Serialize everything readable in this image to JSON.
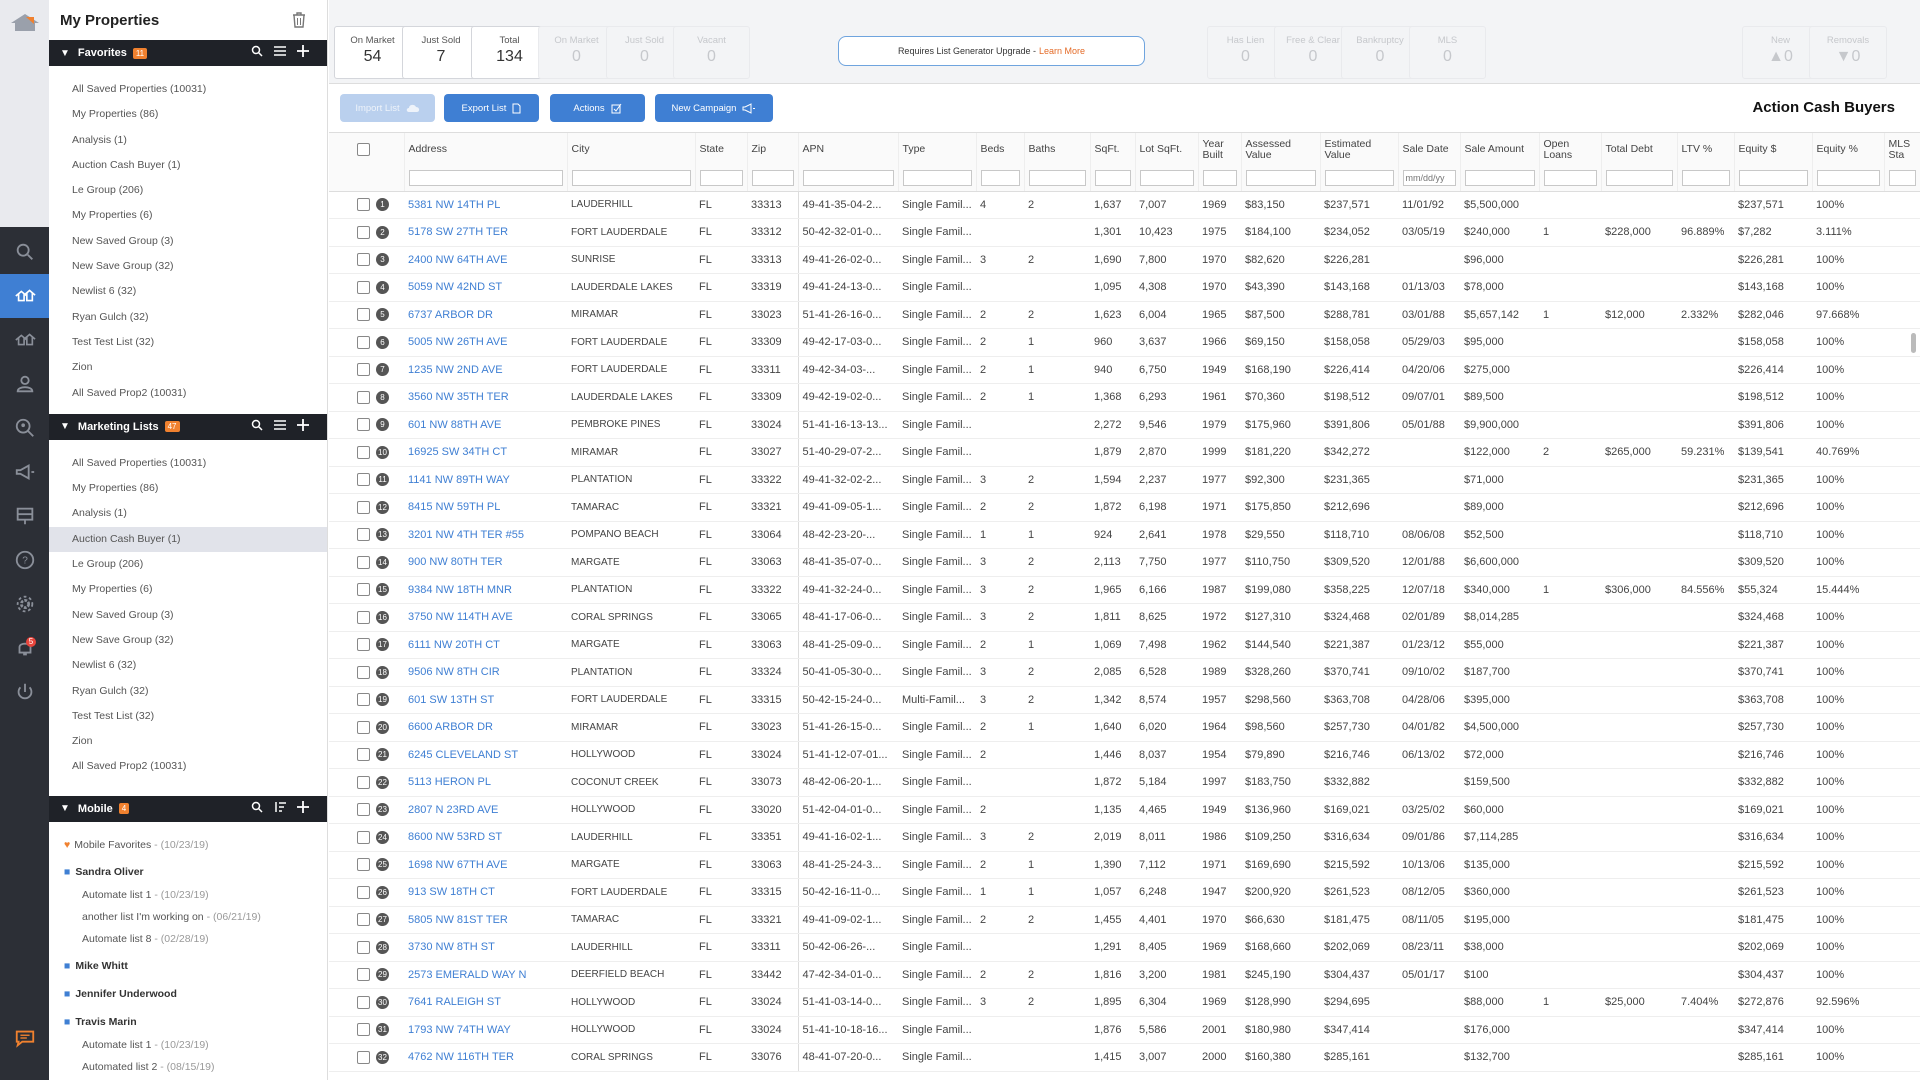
{
  "sidebar": {
    "title": "My Properties",
    "favorites": {
      "label": "Favorites",
      "count": "11"
    },
    "favorite_items": [
      "All Saved Properties (10031)",
      "My Properties (86)",
      "Analysis (1)",
      "Auction Cash Buyer (1)",
      "Le Group (206)",
      "My Properties (6)",
      "New Saved Group (3)",
      "New Save Group (32)",
      "Newlist 6 (32)",
      "Ryan Gulch (32)",
      "Test Test List (32)",
      "Zion",
      "All Saved Prop2 (10031)"
    ],
    "marketing": {
      "label": "Marketing Lists",
      "count": "47"
    },
    "marketing_items": [
      "All Saved Properties (10031)",
      "My Properties (86)",
      "Analysis (1)",
      "Auction Cash Buyer (1)",
      "Le Group (206)",
      "My Properties (6)",
      "New Saved Group (3)",
      "New Save Group (32)",
      "Newlist 6 (32)",
      "Ryan Gulch (32)",
      "Test Test List (32)",
      "Zion",
      "All Saved Prop2 (10031)"
    ],
    "mobile": {
      "label": "Mobile",
      "count": "4"
    },
    "mobile_items": [
      {
        "kind": "fav",
        "label": "Mobile Favorites",
        "date": " - (10/23/19)"
      },
      {
        "kind": "folder",
        "label": "Sandra Oliver"
      },
      {
        "kind": "sub",
        "label": "Automate list 1",
        "date": " - (10/23/19)"
      },
      {
        "kind": "sub",
        "label": "another list I'm working on",
        "date": " - (06/21/19)"
      },
      {
        "kind": "sub",
        "label": "Automate list 8",
        "date": " - (02/28/19)"
      },
      {
        "kind": "folder",
        "label": "Mike Whitt"
      },
      {
        "kind": "folder",
        "label": "Jennifer Underwood"
      },
      {
        "kind": "folder",
        "label": "Travis Marin"
      },
      {
        "kind": "sub",
        "label": "Automate list 1",
        "date": " - (10/23/19)"
      },
      {
        "kind": "sub",
        "label": "Automated list 2",
        "date": " - (08/15/19)"
      }
    ]
  },
  "icon_bar": {
    "notification_count": "5"
  },
  "stats": [
    {
      "label": "On Market",
      "value": "54",
      "dim": false
    },
    {
      "label": "Just Sold",
      "value": "7",
      "dim": false
    },
    {
      "label": "Total",
      "value": "134",
      "dim": false
    },
    {
      "label": "On Market",
      "value": "0",
      "dim": true
    },
    {
      "label": "Just Sold",
      "value": "0",
      "dim": true
    },
    {
      "label": "Vacant",
      "value": "0",
      "dim": true
    },
    {
      "label": "Has Lien",
      "value": "0",
      "dim": true
    },
    {
      "label": "Free & Clear",
      "value": "0",
      "dim": true
    },
    {
      "label": "Bankruptcy",
      "value": "0",
      "dim": true
    },
    {
      "label": "MLS",
      "value": "0",
      "dim": true
    },
    {
      "label": "New",
      "value": "▲0",
      "dim": true
    },
    {
      "label": "Removals",
      "value": "▼0",
      "dim": true
    }
  ],
  "upgrade": {
    "text": "Requires List Generator Upgrade - ",
    "link": "Learn More"
  },
  "toolbar": {
    "import": "Import List",
    "export": "Export List",
    "actions": "Actions",
    "campaign": "New Campaign",
    "list_title": "Action Cash Buyers"
  },
  "table": {
    "columns": [
      "",
      "Address",
      "City",
      "State",
      "Zip",
      "APN",
      "Type",
      "Beds",
      "Baths",
      "SqFt.",
      "Lot SqFt.",
      "Year Built",
      "Assessed Value",
      "Estimated Value",
      "Sale Date",
      "Sale Amount",
      "Open Loans",
      "Total Debt",
      "LTV %",
      "Equity $",
      "Equity %",
      "MLS Sta"
    ],
    "date_placeholder": "mm/dd/yy",
    "rows": [
      [
        "5381 NW 14TH PL",
        "LAUDERHILL",
        "FL",
        "33313",
        "49-41-35-04-2...",
        "Single Famil...",
        "4",
        "2",
        "1,637",
        "7,007",
        "1969",
        "$83,150",
        "$237,571",
        "11/01/92",
        "$5,500,000",
        "",
        "",
        "",
        "$237,571",
        "100%"
      ],
      [
        "5178 SW 27TH TER",
        "FORT LAUDERDALE",
        "FL",
        "33312",
        "50-42-32-01-0...",
        "Single Famil...",
        "",
        "",
        "1,301",
        "10,423",
        "1975",
        "$184,100",
        "$234,052",
        "03/05/19",
        "$240,000",
        "1",
        "$228,000",
        "96.889%",
        "$7,282",
        "3.111%"
      ],
      [
        "2400 NW 64TH AVE",
        "SUNRISE",
        "FL",
        "33313",
        "49-41-26-02-0...",
        "Single Famil...",
        "3",
        "2",
        "1,690",
        "7,800",
        "1970",
        "$82,620",
        "$226,281",
        "",
        "$96,000",
        "",
        "",
        "",
        "$226,281",
        "100%"
      ],
      [
        "5059 NW 42ND ST",
        "LAUDERDALE LAKES",
        "FL",
        "33319",
        "49-41-24-13-0...",
        "Single Famil...",
        "",
        "",
        "1,095",
        "4,308",
        "1970",
        "$43,390",
        "$143,168",
        "01/13/03",
        "$78,000",
        "",
        "",
        "",
        "$143,168",
        "100%"
      ],
      [
        "6737 ARBOR DR",
        "MIRAMAR",
        "FL",
        "33023",
        "51-41-26-16-0...",
        "Single Famil...",
        "2",
        "2",
        "1,623",
        "6,004",
        "1965",
        "$87,500",
        "$288,781",
        "03/01/88",
        "$5,657,142",
        "1",
        "$12,000",
        "2.332%",
        "$282,046",
        "97.668%"
      ],
      [
        "5005 NW 26TH AVE",
        "FORT LAUDERDALE",
        "FL",
        "33309",
        "49-42-17-03-0...",
        "Single Famil...",
        "2",
        "1",
        "960",
        "3,637",
        "1966",
        "$69,150",
        "$158,058",
        "05/29/03",
        "$95,000",
        "",
        "",
        "",
        "$158,058",
        "100%"
      ],
      [
        "1235 NW 2ND AVE",
        "FORT LAUDERDALE",
        "FL",
        "33311",
        "49-42-34-03-...",
        "Single Famil...",
        "2",
        "1",
        "940",
        "6,750",
        "1949",
        "$168,190",
        "$226,414",
        "04/20/06",
        "$275,000",
        "",
        "",
        "",
        "$226,414",
        "100%"
      ],
      [
        "3560 NW 35TH TER",
        "LAUDERDALE LAKES",
        "FL",
        "33309",
        "49-42-19-02-0...",
        "Single Famil...",
        "2",
        "1",
        "1,368",
        "6,293",
        "1961",
        "$70,360",
        "$198,512",
        "09/07/01",
        "$89,500",
        "",
        "",
        "",
        "$198,512",
        "100%"
      ],
      [
        "601 NW 88TH AVE",
        "PEMBROKE PINES",
        "FL",
        "33024",
        "51-41-16-13-13...",
        "Single Famil...",
        "",
        "",
        "2,272",
        "9,546",
        "1979",
        "$175,960",
        "$391,806",
        "05/01/88",
        "$9,900,000",
        "",
        "",
        "",
        "$391,806",
        "100%"
      ],
      [
        "16925 SW 34TH CT",
        "MIRAMAR",
        "FL",
        "33027",
        "51-40-29-07-2...",
        "Single Famil...",
        "",
        "",
        "1,879",
        "2,870",
        "1999",
        "$181,220",
        "$342,272",
        "",
        "$122,000",
        "2",
        "$265,000",
        "59.231%",
        "$139,541",
        "40.769%"
      ],
      [
        "1141 NW 89TH WAY",
        "PLANTATION",
        "FL",
        "33322",
        "49-41-32-02-2...",
        "Single Famil...",
        "3",
        "2",
        "1,594",
        "2,237",
        "1977",
        "$92,300",
        "$231,365",
        "",
        "$71,000",
        "",
        "",
        "",
        "$231,365",
        "100%"
      ],
      [
        "8415 NW 59TH PL",
        "TAMARAC",
        "FL",
        "33321",
        "49-41-09-05-1...",
        "Single Famil...",
        "2",
        "2",
        "1,872",
        "6,198",
        "1971",
        "$175,850",
        "$212,696",
        "",
        "$89,000",
        "",
        "",
        "",
        "$212,696",
        "100%"
      ],
      [
        "3201 NW 4TH TER #55",
        "POMPANO BEACH",
        "FL",
        "33064",
        "48-42-23-20-...",
        "Single Famil...",
        "1",
        "1",
        "924",
        "2,641",
        "1978",
        "$29,550",
        "$118,710",
        "08/06/08",
        "$52,500",
        "",
        "",
        "",
        "$118,710",
        "100%"
      ],
      [
        "900 NW 80TH TER",
        "MARGATE",
        "FL",
        "33063",
        "48-41-35-07-0...",
        "Single Famil...",
        "3",
        "2",
        "2,113",
        "7,750",
        "1977",
        "$110,750",
        "$309,520",
        "12/01/88",
        "$6,600,000",
        "",
        "",
        "",
        "$309,520",
        "100%"
      ],
      [
        "9384 NW 18TH MNR",
        "PLANTATION",
        "FL",
        "33322",
        "49-41-32-24-0...",
        "Single Famil...",
        "3",
        "2",
        "1,965",
        "6,166",
        "1987",
        "$199,080",
        "$358,225",
        "12/07/18",
        "$340,000",
        "1",
        "$306,000",
        "84.556%",
        "$55,324",
        "15.444%"
      ],
      [
        "3750 NW 114TH AVE",
        "CORAL SPRINGS",
        "FL",
        "33065",
        "48-41-17-06-0...",
        "Single Famil...",
        "3",
        "2",
        "1,811",
        "8,625",
        "1972",
        "$127,310",
        "$324,468",
        "02/01/89",
        "$8,014,285",
        "",
        "",
        "",
        "$324,468",
        "100%"
      ],
      [
        "6111 NW 20TH CT",
        "MARGATE",
        "FL",
        "33063",
        "48-41-25-09-0...",
        "Single Famil...",
        "2",
        "1",
        "1,069",
        "7,498",
        "1962",
        "$144,540",
        "$221,387",
        "01/23/12",
        "$55,000",
        "",
        "",
        "",
        "$221,387",
        "100%"
      ],
      [
        "9506 NW 8TH CIR",
        "PLANTATION",
        "FL",
        "33324",
        "50-41-05-30-0...",
        "Single Famil...",
        "3",
        "2",
        "2,085",
        "6,528",
        "1989",
        "$328,260",
        "$370,741",
        "09/10/02",
        "$187,700",
        "",
        "",
        "",
        "$370,741",
        "100%"
      ],
      [
        "601 SW 13TH ST",
        "FORT LAUDERDALE",
        "FL",
        "33315",
        "50-42-15-24-0...",
        "Multi-Famil...",
        "3",
        "2",
        "1,342",
        "8,574",
        "1957",
        "$298,560",
        "$363,708",
        "04/28/06",
        "$395,000",
        "",
        "",
        "",
        "$363,708",
        "100%"
      ],
      [
        "6600 ARBOR DR",
        "MIRAMAR",
        "FL",
        "33023",
        "51-41-26-15-0...",
        "Single Famil...",
        "2",
        "1",
        "1,640",
        "6,020",
        "1964",
        "$98,560",
        "$257,730",
        "04/01/82",
        "$4,500,000",
        "",
        "",
        "",
        "$257,730",
        "100%"
      ],
      [
        "6245 CLEVELAND ST",
        "HOLLYWOOD",
        "FL",
        "33024",
        "51-41-12-07-01...",
        "Single Famil...",
        "2",
        "",
        "1,446",
        "8,037",
        "1954",
        "$79,890",
        "$216,746",
        "06/13/02",
        "$72,000",
        "",
        "",
        "",
        "$216,746",
        "100%"
      ],
      [
        "5113 HERON PL",
        "COCONUT CREEK",
        "FL",
        "33073",
        "48-42-06-20-1...",
        "Single Famil...",
        "",
        "",
        "1,872",
        "5,184",
        "1997",
        "$183,750",
        "$332,882",
        "",
        "$159,500",
        "",
        "",
        "",
        "$332,882",
        "100%"
      ],
      [
        "2807 N 23RD AVE",
        "HOLLYWOOD",
        "FL",
        "33020",
        "51-42-04-01-0...",
        "Single Famil...",
        "2",
        "",
        "1,135",
        "4,465",
        "1949",
        "$136,960",
        "$169,021",
        "03/25/02",
        "$60,000",
        "",
        "",
        "",
        "$169,021",
        "100%"
      ],
      [
        "8600 NW 53RD ST",
        "LAUDERHILL",
        "FL",
        "33351",
        "49-41-16-02-1...",
        "Single Famil...",
        "3",
        "2",
        "2,019",
        "8,011",
        "1986",
        "$109,250",
        "$316,634",
        "09/01/86",
        "$7,114,285",
        "",
        "",
        "",
        "$316,634",
        "100%"
      ],
      [
        "1698 NW 67TH AVE",
        "MARGATE",
        "FL",
        "33063",
        "48-41-25-24-3...",
        "Single Famil...",
        "2",
        "1",
        "1,390",
        "7,112",
        "1971",
        "$169,690",
        "$215,592",
        "10/13/06",
        "$135,000",
        "",
        "",
        "",
        "$215,592",
        "100%"
      ],
      [
        "913 SW 18TH CT",
        "FORT LAUDERDALE",
        "FL",
        "33315",
        "50-42-16-11-0...",
        "Single Famil...",
        "1",
        "1",
        "1,057",
        "6,248",
        "1947",
        "$200,920",
        "$261,523",
        "08/12/05",
        "$360,000",
        "",
        "",
        "",
        "$261,523",
        "100%"
      ],
      [
        "5805 NW 81ST TER",
        "TAMARAC",
        "FL",
        "33321",
        "49-41-09-02-1...",
        "Single Famil...",
        "2",
        "2",
        "1,455",
        "4,401",
        "1970",
        "$66,630",
        "$181,475",
        "08/11/05",
        "$195,000",
        "",
        "",
        "",
        "$181,475",
        "100%"
      ],
      [
        "3730 NW 8TH ST",
        "LAUDERHILL",
        "FL",
        "33311",
        "50-42-06-26-...",
        "Single Famil...",
        "",
        "",
        "1,291",
        "8,405",
        "1969",
        "$168,660",
        "$202,069",
        "08/23/11",
        "$38,000",
        "",
        "",
        "",
        "$202,069",
        "100%"
      ],
      [
        "2573 EMERALD WAY N",
        "DEERFIELD BEACH",
        "FL",
        "33442",
        "47-42-34-01-0...",
        "Single Famil...",
        "2",
        "2",
        "1,816",
        "3,200",
        "1981",
        "$245,190",
        "$304,437",
        "05/01/17",
        "$100",
        "",
        "",
        "",
        "$304,437",
        "100%"
      ],
      [
        "7641 RALEIGH ST",
        "HOLLYWOOD",
        "FL",
        "33024",
        "51-41-03-14-0...",
        "Single Famil...",
        "3",
        "2",
        "1,895",
        "6,304",
        "1969",
        "$128,990",
        "$294,695",
        "",
        "$88,000",
        "1",
        "$25,000",
        "7.404%",
        "$272,876",
        "92.596%"
      ],
      [
        "1793 NW 74TH WAY",
        "HOLLYWOOD",
        "FL",
        "33024",
        "51-41-10-18-16...",
        "Single Famil...",
        "",
        "",
        "1,876",
        "5,586",
        "2001",
        "$180,980",
        "$347,414",
        "",
        "$176,000",
        "",
        "",
        "",
        "$347,414",
        "100%"
      ],
      [
        "4762 NW 116TH TER",
        "CORAL SPRINGS",
        "FL",
        "33076",
        "48-41-07-20-0...",
        "Single Famil...",
        "",
        "",
        "1,415",
        "3,007",
        "2000",
        "$160,380",
        "$285,161",
        "",
        "$132,700",
        "",
        "",
        "",
        "$285,161",
        "100%"
      ]
    ]
  }
}
